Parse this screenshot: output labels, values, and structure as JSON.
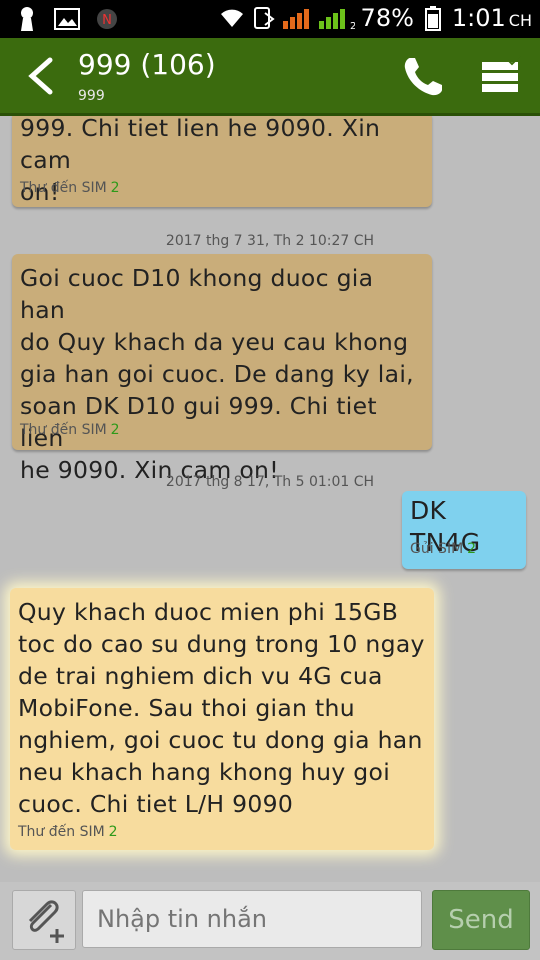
{
  "status_bar": {
    "sim_label": "N",
    "sim2_index": "2",
    "battery_percent": "78%",
    "time": "1:01",
    "time_suffix": "CH"
  },
  "header": {
    "title": "999 (106)",
    "subtitle": "999"
  },
  "messages": [
    {
      "direction": "incoming",
      "text": "999. Chi tiet lien he 9090. Xin cam\non!",
      "meta": "Thư đến SIM",
      "sim": "2"
    },
    {
      "type": "timestamp",
      "text": "2017 thg 7 31, Th 2 10:27 CH"
    },
    {
      "direction": "incoming",
      "text": "Goi cuoc D10 khong duoc gia han\ndo Quy khach da yeu cau khong\ngia han goi cuoc. De dang ky lai,\nsoan DK D10 gui 999. Chi tiet lien\nhe 9090. Xin cam on!",
      "meta": "Thư đến SIM",
      "sim": "2"
    },
    {
      "type": "timestamp",
      "text": "2017 thg 8 17, Th 5 01:01 CH"
    },
    {
      "direction": "outgoing",
      "text": "DK TN4G",
      "meta": "Gửi SIM",
      "sim": "2"
    },
    {
      "direction": "incoming",
      "highlighted": true,
      "text": "Quy khach duoc mien phi 15GB\ntoc do cao su dung trong 10 ngay\nde trai nghiem dich vu 4G cua\nMobiFone. Sau thoi gian thu\nnghiem, goi cuoc tu dong gia han\nneu khach hang khong huy goi\ncuoc. Chi tiet L/H 9090",
      "meta": "Thư đến SIM",
      "sim": "2"
    }
  ],
  "composer": {
    "placeholder": "Nhập tin nhắn",
    "send_label": "Send"
  },
  "colors": {
    "header": "#3b6b0e",
    "incoming_bubble": "#c9ad7a",
    "outgoing_bubble": "#7fd1ee",
    "highlighted_bubble": "#f7dc9e",
    "sim_number": "#2e9a1a"
  }
}
